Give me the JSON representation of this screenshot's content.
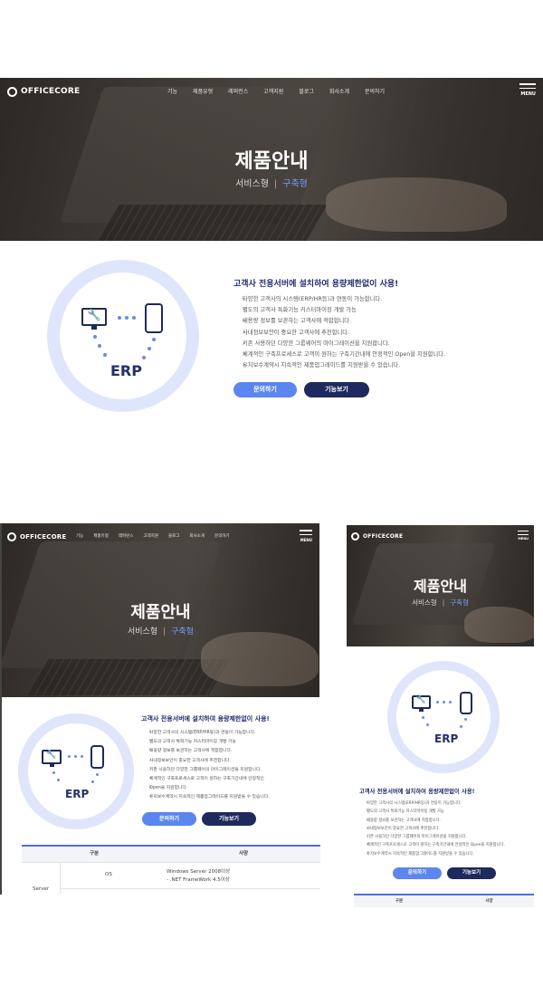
{
  "brand": {
    "name": "OFFICECORE",
    "menu_label": "MENU"
  },
  "nav": {
    "items": [
      "기능",
      "제품유형",
      "레퍼런스",
      "고객지원",
      "블로그",
      "회사소개",
      "문의하기"
    ]
  },
  "hero": {
    "title": "제품안내",
    "tab_service": "서비스형",
    "separator": "|",
    "tab_build": "구축형"
  },
  "erp": {
    "label": "ERP"
  },
  "content": {
    "heading": "고객사 전용서버에 설치하여 용량제한없이 사용!",
    "bullets": [
      "다양한 고객사의 시스템(ERP/HR등)과 연동이 가능합니다.",
      "별도의 고객사 특화기능 커스터마이징 개발 가능",
      "대용량 정보를 보관하는 고객사에 적합합니다.",
      "사내정보보안이 중요한 고객사에 추천합니다.",
      "기존 사용하던 다양한 그룹웨어의 마이그레이션을 지원합니다.",
      "체계적인 구축프로세스로 고객이 원하는 구축기간내에 안정적인 Open을 지원합니다.",
      "유지보수계약시 지속적인 제품업그레이드를 지원받을 수 있습니다."
    ],
    "bullets_tablet": [
      "다양한 고객사의 시스템(ERP/HR등)과 연동이 가능합니다.",
      "별도의 고객사 특화기능 커스터마이징 개발 가능",
      "대용량 정보를 보관하는 고객사에 적합합니다.",
      "사내정보보안이 중요한 고객사에 추천합니다.",
      "기존 사용하던 다양한 그룹웨어의 마이그레이션을 지원합니다.",
      "체계적인 구축프로세스로 고객이 원하는 구축기간내에 안정적인",
      "Open을 지원합니다.",
      "유지보수계약시 지속적인 제품업그레이드를 지원받을 수 있습니다."
    ],
    "btn_inquiry": "문의하기",
    "btn_features": "기능보기"
  },
  "spec_table": {
    "col_category": "구분",
    "col_spec": "사양",
    "row_group": "Server",
    "row_os": "OS",
    "os_spec_line1": "Windows Server 2008이상",
    "os_spec_line2": "- .NET FrameWork 4.5이상"
  }
}
